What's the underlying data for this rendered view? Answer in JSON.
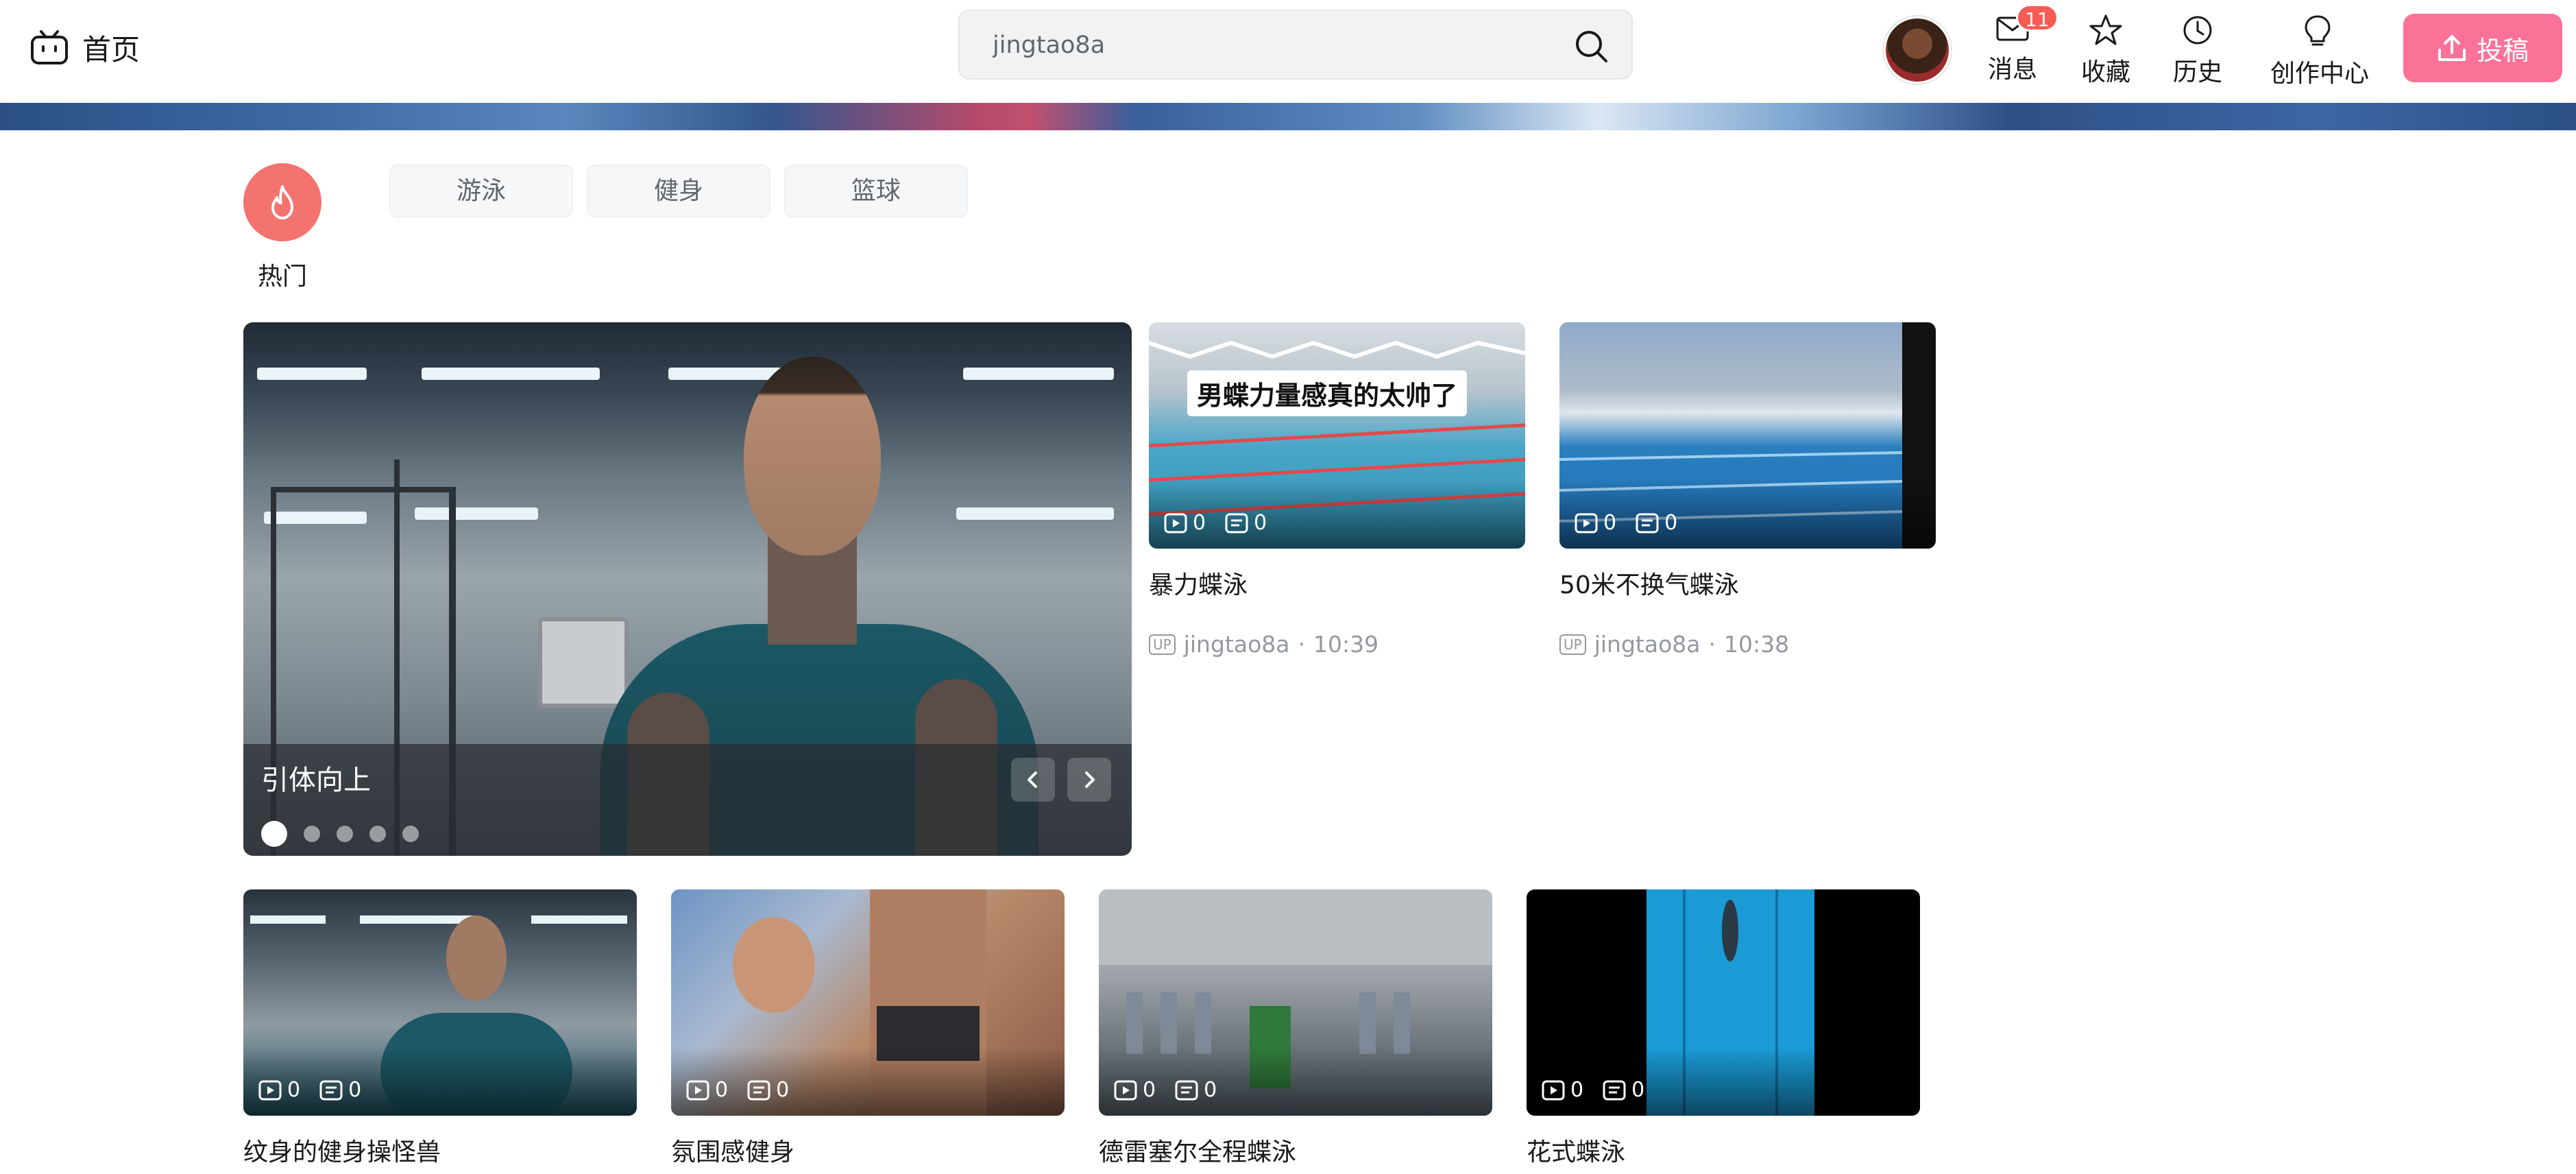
{
  "header": {
    "home_label": "首页",
    "search": {
      "value": "jingtao8a",
      "placeholder": ""
    },
    "nav": [
      {
        "label": "消息",
        "badge": "11"
      },
      {
        "label": "收藏"
      },
      {
        "label": "历史"
      },
      {
        "label": "创作中心"
      }
    ],
    "upload_label": "投稿"
  },
  "channels": {
    "hot_label": "热门",
    "tabs": [
      "游泳",
      "健身",
      "篮球"
    ]
  },
  "carousel": {
    "title": "引体向上",
    "dot_count": 5,
    "active_index": 0
  },
  "feature_cards": [
    {
      "overlay": "男蝶力量感真的太帅了",
      "views": "0",
      "comments": "0",
      "title": "暴力蝶泳",
      "up_tag": "UP",
      "uploader": "jingtao8a",
      "time": "10:39",
      "thumb_colors": [
        "#b8c4cc",
        "#2f8fb0"
      ]
    },
    {
      "views": "0",
      "comments": "0",
      "title": "50米不换气蝶泳",
      "up_tag": "UP",
      "uploader": "jingtao8a",
      "time": "10:38",
      "thumb_colors": [
        "#7f9fc6",
        "#1f6fb4"
      ]
    }
  ],
  "video_cards": [
    {
      "views": "0",
      "comments": "0",
      "title": "纹身的健身操怪兽",
      "thumb_colors": [
        "#3b4a56",
        "#1d5664"
      ]
    },
    {
      "views": "0",
      "comments": "0",
      "title": "氛围感健身",
      "thumb_colors": [
        "#6e93c4",
        "#b78a6c"
      ]
    },
    {
      "views": "0",
      "comments": "0",
      "title": "德雷塞尔全程蝶泳",
      "thumb_colors": [
        "#9aa0a6",
        "#5d6a72"
      ]
    },
    {
      "views": "0",
      "comments": "0",
      "title": "花式蝶泳",
      "thumb_colors": [
        "#000000",
        "#1a9bd6"
      ]
    }
  ],
  "colors": {
    "accent_pink": "#fb7299",
    "hot_red": "#f5736e",
    "badge_red": "#f85a54",
    "meta_gray": "#9499a0"
  }
}
